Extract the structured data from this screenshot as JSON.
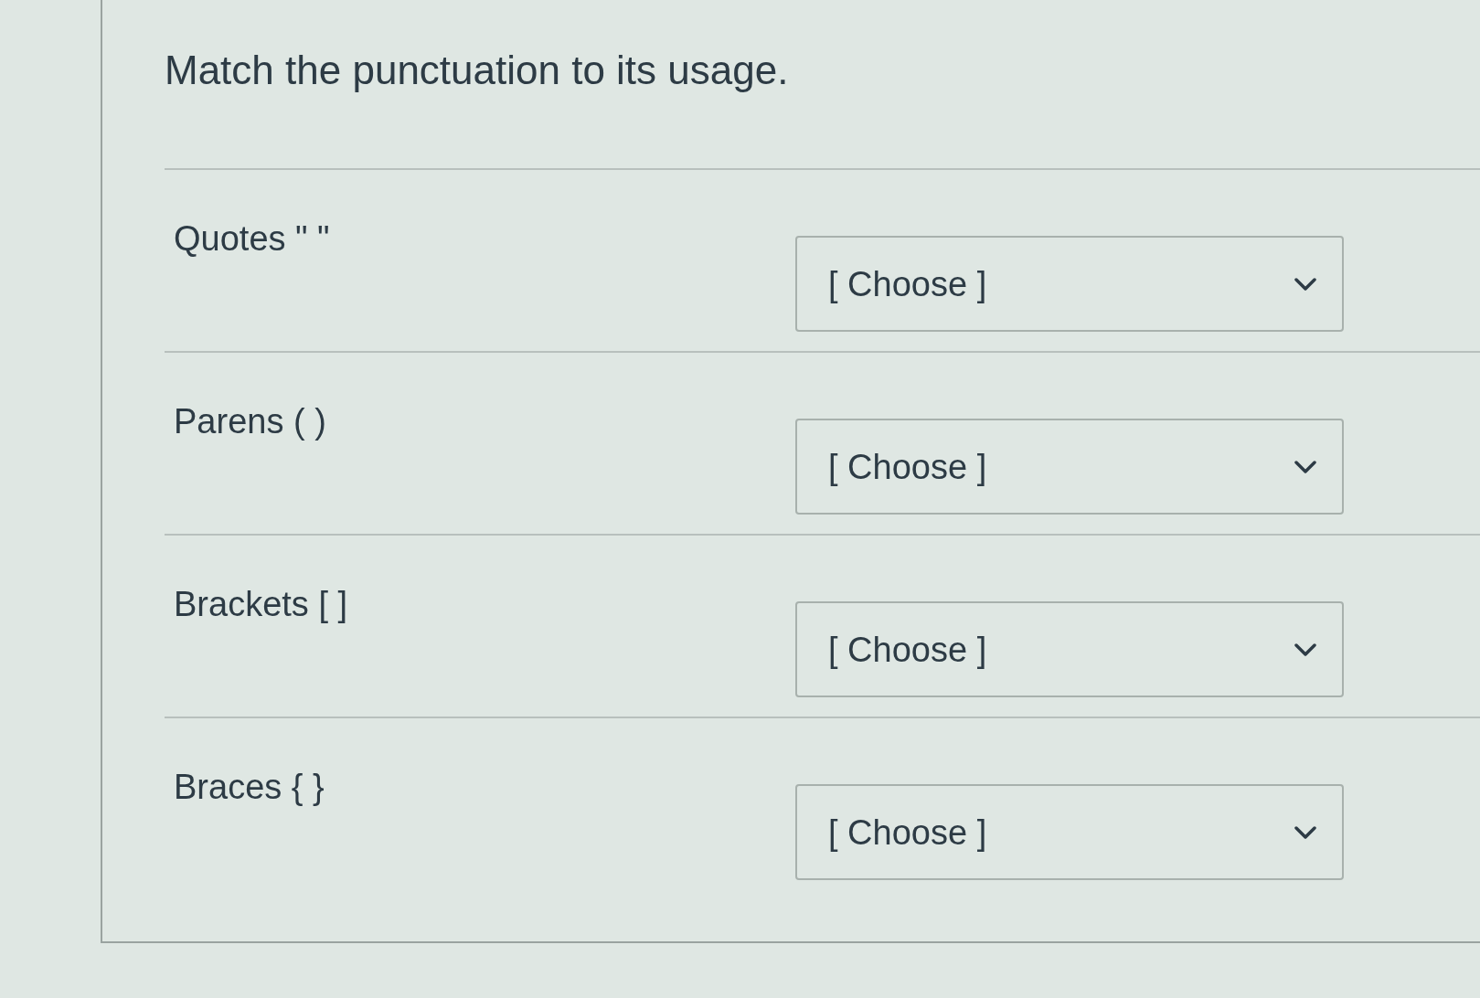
{
  "question": {
    "prompt": "Match the punctuation to its usage."
  },
  "rows": [
    {
      "label": "Quotes \" \"",
      "dropdown": {
        "value": "[ Choose ]"
      }
    },
    {
      "label": "Parens ( )",
      "dropdown": {
        "value": "[ Choose ]"
      }
    },
    {
      "label": "Brackets [ ]",
      "dropdown": {
        "value": "[ Choose ]"
      }
    },
    {
      "label": "Braces { }",
      "dropdown": {
        "value": "[ Choose ]"
      }
    }
  ]
}
